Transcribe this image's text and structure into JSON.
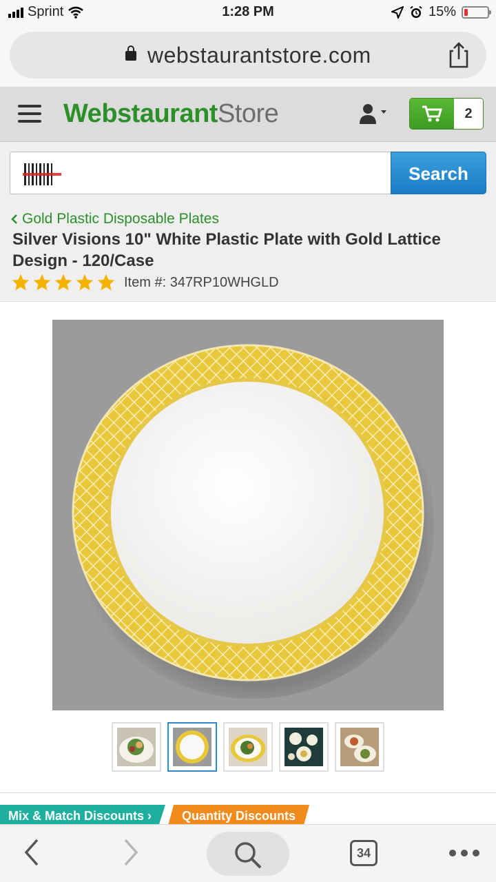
{
  "status_bar": {
    "carrier": "Sprint",
    "time": "1:28 PM",
    "battery_percent": "15%",
    "battery_level": 0.15
  },
  "browser": {
    "url": "webstaurantstore.com"
  },
  "header": {
    "logo_bold": "Webstaurant",
    "logo_light": "Store",
    "cart_count": "2"
  },
  "search": {
    "placeholder": "",
    "button_label": "Search"
  },
  "product": {
    "breadcrumb": "Gold Plastic Disposable Plates",
    "title": "Silver Visions 10\" White Plastic Plate with Gold Lattice Design - 120/Case",
    "rating": 5,
    "item_number": "Item #: 347RP10WHGLD"
  },
  "gallery": {
    "thumbnails": [
      {
        "name": "salad-plate-photo",
        "active": false
      },
      {
        "name": "plate-top-view",
        "active": true
      },
      {
        "name": "salad-plate-photo-2",
        "active": false
      },
      {
        "name": "table-setting-photo",
        "active": false
      },
      {
        "name": "buffet-photo",
        "active": false
      }
    ]
  },
  "discounts": {
    "mix_match": "Mix & Match Discounts",
    "quantity": "Quantity Discounts"
  },
  "toolbar": {
    "tab_count": "34"
  },
  "colors": {
    "brand_green": "#2c8f2a",
    "search_blue": "#1b7cc4",
    "gold": "#e8c73a"
  }
}
